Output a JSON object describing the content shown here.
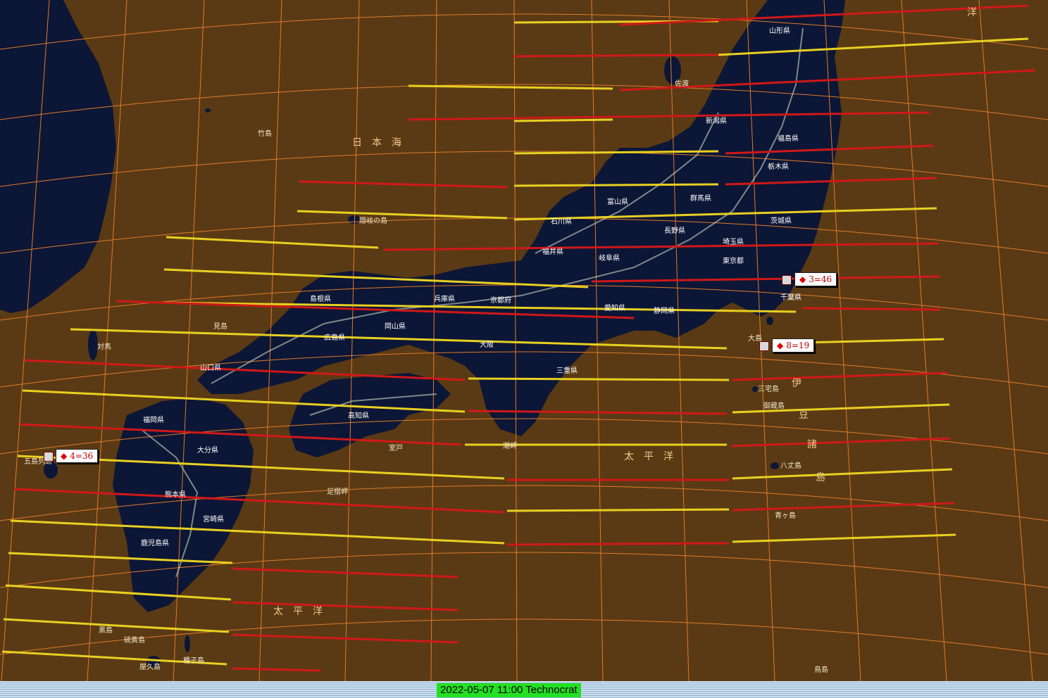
{
  "status": {
    "text": "2022-05-07 11:00 Technocrat"
  },
  "colors": {
    "background": "#5a3a14",
    "land": "#0c1636",
    "grid": "#e07a2a",
    "line_yellow": "#e8d020",
    "line_red": "#d01818"
  },
  "seas": [
    {
      "name": "sea-japan",
      "text": "日　本　海"
    },
    {
      "name": "sea-pacific-center",
      "text": "太　平　洋"
    },
    {
      "name": "sea-pacific-south",
      "text": "太　平　洋"
    },
    {
      "name": "sea-pacific-ne",
      "text": "洋"
    },
    {
      "name": "islands-izu-1",
      "text": "伊"
    },
    {
      "name": "islands-izu-2",
      "text": "豆"
    },
    {
      "name": "islands-izu-3",
      "text": "諸"
    },
    {
      "name": "islands-izu-4",
      "text": "島"
    }
  ],
  "places": [
    {
      "name": "place-takeshima",
      "text": "竹島"
    },
    {
      "name": "place-oki",
      "text": "隠岐の島"
    },
    {
      "name": "place-tsushima",
      "text": "対馬"
    },
    {
      "name": "place-goto",
      "text": "五島列島"
    },
    {
      "name": "place-mishima",
      "text": "見島"
    },
    {
      "name": "place-oshima",
      "text": "大島"
    },
    {
      "name": "place-miyake",
      "text": "三宅島"
    },
    {
      "name": "place-mikura",
      "text": "御蔵島"
    },
    {
      "name": "place-hachijo",
      "text": "八丈島"
    },
    {
      "name": "place-aogashima",
      "text": "青ヶ島"
    },
    {
      "name": "place-yakushima",
      "text": "屋久島"
    },
    {
      "name": "place-tanegashima",
      "text": "種子島"
    },
    {
      "name": "place-sado",
      "text": "佐渡"
    },
    {
      "name": "place-ashizuri",
      "text": "足摺岬"
    },
    {
      "name": "place-muroto",
      "text": "室戸"
    },
    {
      "name": "place-shiono",
      "text": "潮岬"
    },
    {
      "name": "place-torishima",
      "text": "鳥島"
    },
    {
      "name": "place-kuroshima",
      "text": "黒島"
    },
    {
      "name": "place-iojima",
      "text": "硫黄島"
    }
  ],
  "prefectures": [
    {
      "name": "pref-tokyo",
      "text": "東京都"
    },
    {
      "name": "pref-osaka",
      "text": "大阪"
    },
    {
      "name": "pref-kyoto",
      "text": "京都府"
    },
    {
      "name": "pref-hiroshima",
      "text": "広島県"
    },
    {
      "name": "pref-fukuoka",
      "text": "福岡県"
    },
    {
      "name": "pref-kagoshima",
      "text": "鹿児島県"
    },
    {
      "name": "pref-miyazaki",
      "text": "宮崎県"
    },
    {
      "name": "pref-kochi",
      "text": "高知県"
    },
    {
      "name": "pref-niigata",
      "text": "新潟県"
    },
    {
      "name": "pref-nagano",
      "text": "長野県"
    },
    {
      "name": "pref-fukushima",
      "text": "福島県"
    },
    {
      "name": "pref-yamagata",
      "text": "山形県"
    },
    {
      "name": "pref-aichi",
      "text": "愛知県"
    },
    {
      "name": "pref-shizuoka",
      "text": "静岡県"
    },
    {
      "name": "pref-chiba",
      "text": "千葉県"
    },
    {
      "name": "pref-ibaraki",
      "text": "茨城県"
    },
    {
      "name": "pref-shimane",
      "text": "島根県"
    },
    {
      "name": "pref-yamaguchi",
      "text": "山口県"
    },
    {
      "name": "pref-kumamoto",
      "text": "熊本県"
    },
    {
      "name": "pref-oita",
      "text": "大分県"
    },
    {
      "name": "pref-okayama",
      "text": "岡山県"
    },
    {
      "name": "pref-hyogo",
      "text": "兵庫県"
    },
    {
      "name": "pref-mie",
      "text": "三重県"
    },
    {
      "name": "pref-gifu",
      "text": "岐阜県"
    },
    {
      "name": "pref-toyama",
      "text": "富山県"
    },
    {
      "name": "pref-ishikawa",
      "text": "石川県"
    },
    {
      "name": "pref-fukui",
      "text": "福井県"
    },
    {
      "name": "pref-tochigi",
      "text": "栃木県"
    },
    {
      "name": "pref-gunma",
      "text": "群馬県"
    },
    {
      "name": "pref-saitama",
      "text": "埼玉県"
    }
  ],
  "markers": [
    {
      "name": "marker-3-46",
      "text": "3=46"
    },
    {
      "name": "marker-8-19",
      "text": "8=19"
    },
    {
      "name": "marker-4-36",
      "text": "4=36"
    }
  ]
}
